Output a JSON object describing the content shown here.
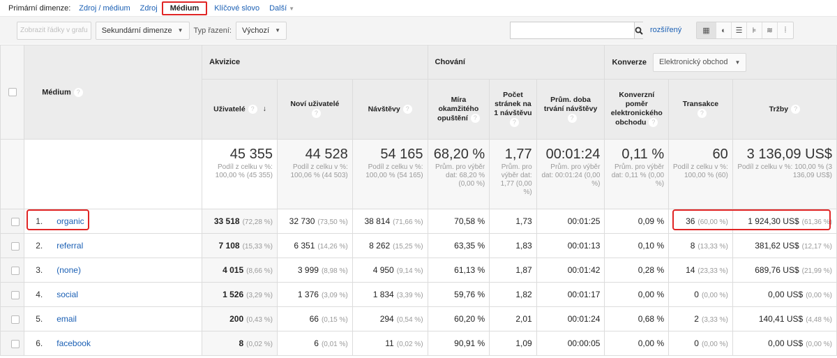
{
  "dimension_bar": {
    "label": "Primární dimenze:",
    "options": [
      "Zdroj / médium",
      "Zdroj",
      "Médium",
      "Klíčové slovo"
    ],
    "active": "Médium",
    "more": "Další"
  },
  "toolbar": {
    "plot_rows": "Zobrazit řádky v grafu",
    "secondary_dimension": "Sekundární dimenze",
    "sort_label": "Typ řazení:",
    "sort_value": "Výchozí",
    "search_value": "",
    "advanced": "rozšířený",
    "views": [
      "table-view",
      "pie-view",
      "performance-view",
      "comparison-view",
      "term-cloud-view",
      "pivot-view"
    ]
  },
  "table": {
    "dimension_header": "Médium",
    "groups": {
      "acquisition": "Akvizice",
      "behavior": "Chování",
      "conversion": "Konverze",
      "conversion_select": "Elektronický obchod"
    },
    "columns": [
      "Uživatelé",
      "Noví uživatelé",
      "Návštěvy",
      "Míra okamžitého opuštění",
      "Počet stránek na 1 návštěvu",
      "Prům. doba trvání návštěvy",
      "Konverzní poměr elektronického obchodu",
      "Transakce",
      "Tržby"
    ],
    "sort_column": "Uživatelé",
    "totals": [
      {
        "value": "45 355",
        "sub": "Podíl z celku v %: 100,00 % (45 355)"
      },
      {
        "value": "44 528",
        "sub": "Podíl z celku v %: 100,06 % (44 503)"
      },
      {
        "value": "54 165",
        "sub": "Podíl z celku v %: 100,00 % (54 165)"
      },
      {
        "value": "68,20 %",
        "sub": "Prům. pro výběr dat: 68,20 % (0,00 %)"
      },
      {
        "value": "1,77",
        "sub": "Prům. pro výběr dat: 1,77 (0,00 %)"
      },
      {
        "value": "00:01:24",
        "sub": "Prům. pro výběr dat: 00:01:24 (0,00 %)"
      },
      {
        "value": "0,11 %",
        "sub": "Prům. pro výběr dat: 0,11 % (0,00 %)"
      },
      {
        "value": "60",
        "sub": "Podíl z celku v %: 100,00 % (60)"
      },
      {
        "value": "3 136,09 US$",
        "sub": "Podíl z celku v %: 100,00 % (3 136,09 US$)"
      }
    ],
    "rows": [
      {
        "index": "1.",
        "medium": "organic",
        "users": "33 518",
        "users_pct": "(72,28 %)",
        "new_users": "32 730",
        "new_users_pct": "(73,50 %)",
        "sessions": "38 814",
        "sessions_pct": "(71,66 %)",
        "bounce": "70,58 %",
        "pages": "1,73",
        "duration": "00:01:25",
        "conv_rate": "0,09 %",
        "transactions": "36",
        "transactions_pct": "(60,00 %)",
        "revenue": "1 924,30 US$",
        "revenue_pct": "(61,36 %)"
      },
      {
        "index": "2.",
        "medium": "referral",
        "users": "7 108",
        "users_pct": "(15,33 %)",
        "new_users": "6 351",
        "new_users_pct": "(14,26 %)",
        "sessions": "8 262",
        "sessions_pct": "(15,25 %)",
        "bounce": "63,35 %",
        "pages": "1,83",
        "duration": "00:01:13",
        "conv_rate": "0,10 %",
        "transactions": "8",
        "transactions_pct": "(13,33 %)",
        "revenue": "381,62 US$",
        "revenue_pct": "(12,17 %)"
      },
      {
        "index": "3.",
        "medium": "(none)",
        "users": "4 015",
        "users_pct": "(8,66 %)",
        "new_users": "3 999",
        "new_users_pct": "(8,98 %)",
        "sessions": "4 950",
        "sessions_pct": "(9,14 %)",
        "bounce": "61,13 %",
        "pages": "1,87",
        "duration": "00:01:42",
        "conv_rate": "0,28 %",
        "transactions": "14",
        "transactions_pct": "(23,33 %)",
        "revenue": "689,76 US$",
        "revenue_pct": "(21,99 %)"
      },
      {
        "index": "4.",
        "medium": "social",
        "users": "1 526",
        "users_pct": "(3,29 %)",
        "new_users": "1 376",
        "new_users_pct": "(3,09 %)",
        "sessions": "1 834",
        "sessions_pct": "(3,39 %)",
        "bounce": "59,76 %",
        "pages": "1,82",
        "duration": "00:01:17",
        "conv_rate": "0,00 %",
        "transactions": "0",
        "transactions_pct": "(0,00 %)",
        "revenue": "0,00 US$",
        "revenue_pct": "(0,00 %)"
      },
      {
        "index": "5.",
        "medium": "email",
        "users": "200",
        "users_pct": "(0,43 %)",
        "new_users": "66",
        "new_users_pct": "(0,15 %)",
        "sessions": "294",
        "sessions_pct": "(0,54 %)",
        "bounce": "60,20 %",
        "pages": "2,01",
        "duration": "00:01:24",
        "conv_rate": "0,68 %",
        "transactions": "2",
        "transactions_pct": "(3,33 %)",
        "revenue": "140,41 US$",
        "revenue_pct": "(4,48 %)"
      },
      {
        "index": "6.",
        "medium": "facebook",
        "users": "8",
        "users_pct": "(0,02 %)",
        "new_users": "6",
        "new_users_pct": "(0,01 %)",
        "sessions": "11",
        "sessions_pct": "(0,02 %)",
        "bounce": "90,91 %",
        "pages": "1,09",
        "duration": "00:00:05",
        "conv_rate": "0,00 %",
        "transactions": "0",
        "transactions_pct": "(0,00 %)",
        "revenue": "0,00 US$",
        "revenue_pct": "(0,00 %)"
      }
    ]
  },
  "colors": {
    "link": "#1a5fb4",
    "highlight": "#e02424",
    "header_bg": "#ececec"
  }
}
